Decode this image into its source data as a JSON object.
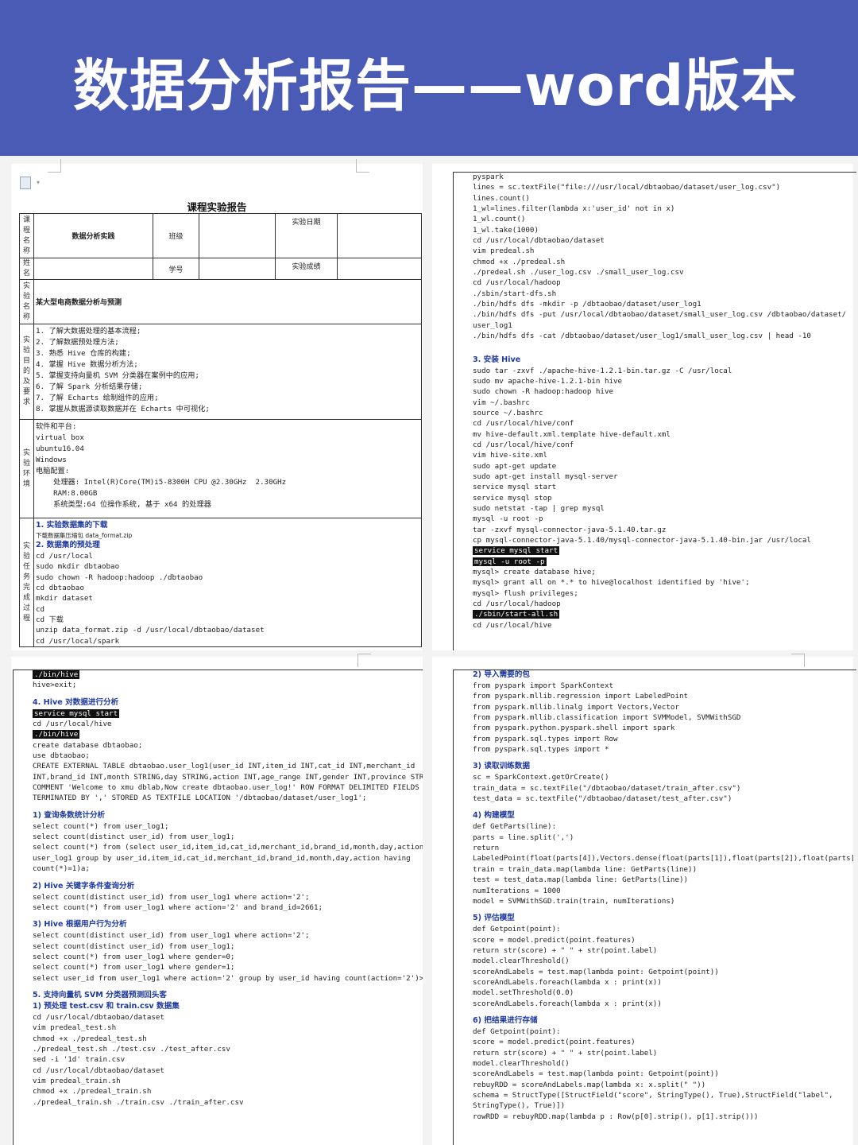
{
  "banner": {
    "title": "数据分析报告——word版本"
  },
  "page1": {
    "doc_title": "课程实验报告",
    "table": {
      "course_label": "课程名称",
      "course_value": "数据分析实践",
      "class_label": "班级",
      "date_label": "实验日期",
      "name_label": "姓名",
      "id_label": "学号",
      "score_label": "实验成绩",
      "exp_name_label": "实验名称",
      "exp_name_value": "某大型电商数据分析与预测",
      "purpose_label": "实验目的及要求",
      "purpose_lines": [
        "1. 了解大数据处理的基本流程;",
        "2. 了解数据预处理方法;",
        "3. 熟悉 Hive 仓库的构建;",
        "4. 掌握 Hive 数据分析方法;",
        "5. 掌握支持向量机 SVM 分类器在案例中的应用;",
        "6. 了解 Spark 分析结果存储;",
        "7. 了解 Echarts 绘制组件的应用;",
        "8. 掌握从数据源读取数据并在 Echarts 中可视化;"
      ],
      "env_label": "实验环境",
      "env_lines": [
        "软件和平台:",
        "virtual box",
        "ubuntu16.04",
        "Windows",
        "电脑配置:",
        "    处理器: Intel(R)Core(TM)i5-8300H CPU @2.30GHz  2.30GHz",
        "    RAM:8.00GB",
        "    系统类型:64 位操作系统, 基于 x64 的处理器"
      ],
      "process_label": "实验任务完成过程",
      "process_lines": [
        {
          "t": "1. 实验数据集的下载",
          "k": "hd"
        },
        {
          "t": "下载数据集压缩包 data_format.zip",
          "k": "small"
        },
        {
          "t": "2. 数据集的预处理",
          "k": "hd"
        },
        {
          "t": "cd /usr/local",
          "k": "ln"
        },
        {
          "t": "sudo mkdir dbtaobao",
          "k": "ln"
        },
        {
          "t": "sudo chown -R hadoop:hadoop ./dbtaobao",
          "k": "ln"
        },
        {
          "t": "cd dbtaobao",
          "k": "ln"
        },
        {
          "t": "mkdir dataset",
          "k": "ln"
        },
        {
          "t": "cd",
          "k": "ln"
        },
        {
          "t": "cd 下载",
          "k": "ln"
        },
        {
          "t": "unzip data_format.zip -d /usr/local/dbtaobao/dataset",
          "k": "ln"
        },
        {
          "t": "cd /usr/local/spark",
          "k": "ln"
        }
      ]
    }
  },
  "page2": {
    "lines": [
      {
        "t": "pyspark",
        "k": "ln"
      },
      {
        "t": "lines = sc.textFile(\"file:///usr/local/dbtaobao/dataset/user_log.csv\")",
        "k": "ln"
      },
      {
        "t": "lines.count()",
        "k": "ln"
      },
      {
        "t": "1_wl=lines.filter(lambda x:'user_id' not in x)",
        "k": "ln"
      },
      {
        "t": "1_wl.count()",
        "k": "ln"
      },
      {
        "t": "1_wl.take(1000)",
        "k": "ln"
      },
      {
        "t": "cd /usr/local/dbtaobao/dataset",
        "k": "ln"
      },
      {
        "t": "vim predeal.sh",
        "k": "ln"
      },
      {
        "t": "chmod +x ./predeal.sh",
        "k": "ln"
      },
      {
        "t": "./predeal.sh ./user_log.csv ./small_user_log.csv",
        "k": "ln"
      },
      {
        "t": "cd /usr/local/hadoop",
        "k": "ln"
      },
      {
        "t": "./sbin/start-dfs.sh",
        "k": "ln"
      },
      {
        "t": "./bin/hdfs dfs -mkdir -p /dbtaobao/dataset/user_log1",
        "k": "ln"
      },
      {
        "t": "./bin/hdfs dfs -put /usr/local/dbtaobao/dataset/small_user_log.csv /dbtaobao/dataset/",
        "k": "ln"
      },
      {
        "t": "user_log1",
        "k": "ln"
      },
      {
        "t": "./bin/hdfs dfs -cat /dbtaobao/dataset/user_log1/small_user_log.csv | head -10",
        "k": "ln"
      },
      {
        "t": "",
        "k": "sp"
      },
      {
        "t": "",
        "k": "sp"
      },
      {
        "t": "3. 安装 Hive",
        "k": "hd"
      },
      {
        "t": "sudo tar -zxvf ./apache-hive-1.2.1-bin.tar.gz -C /usr/local",
        "k": "ln"
      },
      {
        "t": "sudo mv apache-hive-1.2.1-bin hive",
        "k": "ln"
      },
      {
        "t": "sudo chown -R hadoop:hadoop hive",
        "k": "ln"
      },
      {
        "t": "vim ~/.bashrc",
        "k": "ln"
      },
      {
        "t": "source ~/.bashrc",
        "k": "ln"
      },
      {
        "t": "cd /usr/local/hive/conf",
        "k": "ln"
      },
      {
        "t": "mv hive-default.xml.template hive-default.xml",
        "k": "ln"
      },
      {
        "t": "cd /usr/local/hive/conf",
        "k": "ln"
      },
      {
        "t": "vim hive-site.xml",
        "k": "ln"
      },
      {
        "t": "sudo apt-get update",
        "k": "ln"
      },
      {
        "t": "sudo apt-get install mysql-server",
        "k": "ln"
      },
      {
        "t": "service mysql start",
        "k": "ln"
      },
      {
        "t": "service mysql stop",
        "k": "ln"
      },
      {
        "t": "sudo netstat -tap | grep mysql",
        "k": "ln"
      },
      {
        "t": "mysql -u root -p",
        "k": "ln"
      },
      {
        "t": "tar -zxvf mysql-connector-java-5.1.40.tar.gz",
        "k": "ln"
      },
      {
        "t": "cp mysql-connector-java-5.1.40/mysql-connector-java-5.1.40-bin.jar /usr/local",
        "k": "ln"
      },
      {
        "t": "service mysql start",
        "k": "hl"
      },
      {
        "t": "mysql -u root -p",
        "k": "hl"
      },
      {
        "t": "mysql> create database hive;",
        "k": "ln"
      },
      {
        "t": "mysql> grant all on *.* to hive@localhost identified by 'hive';",
        "k": "ln"
      },
      {
        "t": "mysql> flush privileges;",
        "k": "ln"
      },
      {
        "t": "cd /usr/local/hadoop",
        "k": "ln"
      },
      {
        "t": "./sbin/start-all.sh",
        "k": "hl"
      },
      {
        "t": "cd /usr/local/hive",
        "k": "ln"
      }
    ]
  },
  "page3": {
    "lines": [
      {
        "t": "./bin/hive",
        "k": "hl"
      },
      {
        "t": "hive>exit;",
        "k": "ln"
      },
      {
        "t": "",
        "k": "sp"
      },
      {
        "t": "4. Hive 对数据进行分析",
        "k": "hd"
      },
      {
        "t": "service mysql start",
        "k": "hl"
      },
      {
        "t": "cd /usr/local/hive",
        "k": "ln"
      },
      {
        "t": "./bin/hive",
        "k": "hl"
      },
      {
        "t": "create database dbtaobao;",
        "k": "ln"
      },
      {
        "t": "use dbtaobao;",
        "k": "ln"
      },
      {
        "t": "CREATE EXTERNAL TABLE dbtaobao.user_log1(user_id INT,item_id INT,cat_id INT,merchant_id",
        "k": "ln"
      },
      {
        "t": "INT,brand_id INT,month STRING,day STRING,action INT,age_range INT,gender INT,province STRI",
        "k": "ln"
      },
      {
        "t": "COMMENT 'Welcome to xmu dblab,Now create dbtaobao.user_log!' ROW FORMAT DELIMITED FIELDS",
        "k": "ln"
      },
      {
        "t": "TERMINATED BY ',' STORED AS TEXTFILE LOCATION '/dbtaobao/dataset/user_log1';",
        "k": "ln"
      },
      {
        "t": "",
        "k": "sp"
      },
      {
        "t": "1) 查询条数统计分析",
        "k": "hd"
      },
      {
        "t": "select count(*) from user_log1;",
        "k": "ln"
      },
      {
        "t": "select count(distinct user_id) from user_log1;",
        "k": "ln"
      },
      {
        "t": "select count(*) from (select user_id,item_id,cat_id,merchant_id,brand_id,month,day,action f",
        "k": "ln"
      },
      {
        "t": "user_log1 group by user_id,item_id,cat_id,merchant_id,brand_id,month,day,action having",
        "k": "ln"
      },
      {
        "t": "count(*)=1)a;",
        "k": "ln"
      },
      {
        "t": "",
        "k": "sp"
      },
      {
        "t": "2) Hive 关键字条件查询分析",
        "k": "hd"
      },
      {
        "t": "select count(distinct user_id) from user_log1 where action='2';",
        "k": "ln"
      },
      {
        "t": "select count(*) from user_log1 where action='2' and brand_id=2661;",
        "k": "ln"
      },
      {
        "t": "",
        "k": "sp"
      },
      {
        "t": "3) Hive 根据用户行为分析",
        "k": "hd"
      },
      {
        "t": "select count(distinct user_id) from user_log1 where action='2';",
        "k": "ln"
      },
      {
        "t": "select count(distinct user_id) from user_log1;",
        "k": "ln"
      },
      {
        "t": "select count(*) from user_log1 where gender=0;",
        "k": "ln"
      },
      {
        "t": "select count(*) from user_log1 where gender=1;",
        "k": "ln"
      },
      {
        "t": "select user_id from user_log1 where action='2' group by user_id having count(action='2')>",
        "k": "ln"
      },
      {
        "t": "",
        "k": "sp"
      },
      {
        "t": "5. 支持向量机 SVM 分类器预测回头客",
        "k": "hd"
      },
      {
        "t": "1) 预处理 test.csv 和 train.csv 数据集",
        "k": "hd"
      },
      {
        "t": "cd /usr/local/dbtaobao/dataset",
        "k": "ln"
      },
      {
        "t": "vim predeal_test.sh",
        "k": "ln"
      },
      {
        "t": "chmod +x ./predeal_test.sh",
        "k": "ln"
      },
      {
        "t": "./predeal_test.sh ./test.csv ./test_after.csv",
        "k": "ln"
      },
      {
        "t": "sed -i '1d' train.csv",
        "k": "ln"
      },
      {
        "t": "cd /usr/local/dbtaobao/dataset",
        "k": "ln"
      },
      {
        "t": "vim predeal_train.sh",
        "k": "ln"
      },
      {
        "t": "chmod +x ./predeal_train.sh",
        "k": "ln"
      },
      {
        "t": "./predeal_train.sh ./train.csv ./train_after.csv",
        "k": "ln"
      }
    ]
  },
  "page4": {
    "lines": [
      {
        "t": "2) 导入需要的包",
        "k": "hd"
      },
      {
        "t": "from pyspark import SparkContext",
        "k": "ln"
      },
      {
        "t": "from pyspark.mllib.regression import LabeledPoint",
        "k": "ln"
      },
      {
        "t": "from pyspark.mllib.linalg import Vectors,Vector",
        "k": "ln"
      },
      {
        "t": "from pyspark.mllib.classification import SVMModel, SVMWithSGD",
        "k": "ln"
      },
      {
        "t": "from pyspark.python.pyspark.shell import spark",
        "k": "ln"
      },
      {
        "t": "from pyspark.sql.types import Row",
        "k": "ln"
      },
      {
        "t": "from pyspark.sql.types import *",
        "k": "ln"
      },
      {
        "t": "",
        "k": "sp"
      },
      {
        "t": "3) 读取训练数据",
        "k": "hd"
      },
      {
        "t": "sc = SparkContext.getOrCreate()",
        "k": "ln"
      },
      {
        "t": "train_data = sc.textFile(\"/dbtaobao/dataset/train_after.csv\")",
        "k": "ln"
      },
      {
        "t": "test_data = sc.textFile(\"/dbtaobao/dataset/test_after.csv\")",
        "k": "ln"
      },
      {
        "t": "",
        "k": "sp"
      },
      {
        "t": "4) 构建模型",
        "k": "hd"
      },
      {
        "t": "def GetParts(line):",
        "k": "ln"
      },
      {
        "t": "parts = line.split(',')",
        "k": "ln"
      },
      {
        "t": "return",
        "k": "ln"
      },
      {
        "t": "LabeledPoint(float(parts[4]),Vectors.dense(float(parts[1]),float(parts[2]),float(parts[3",
        "k": "ln"
      },
      {
        "t": "train = train_data.map(lambda line: GetParts(line))",
        "k": "ln"
      },
      {
        "t": "test = test_data.map(lambda line: GetParts(line))",
        "k": "ln"
      },
      {
        "t": "numIterations = 1000",
        "k": "ln"
      },
      {
        "t": "model = SVMWithSGD.train(train, numIterations)",
        "k": "ln"
      },
      {
        "t": "",
        "k": "sp"
      },
      {
        "t": "5) 评估模型",
        "k": "hd"
      },
      {
        "t": "def Getpoint(point):",
        "k": "ln"
      },
      {
        "t": "score = model.predict(point.features)",
        "k": "ln"
      },
      {
        "t": "return str(score) + \" \" + str(point.label)",
        "k": "ln"
      },
      {
        "t": "model.clearThreshold()",
        "k": "ln"
      },
      {
        "t": "scoreAndLabels = test.map(lambda point: Getpoint(point))",
        "k": "ln"
      },
      {
        "t": "scoreAndLabels.foreach(lambda x : print(x))",
        "k": "ln"
      },
      {
        "t": "model.setThreshold(0.0)",
        "k": "ln"
      },
      {
        "t": "scoreAndLabels.foreach(lambda x : print(x))",
        "k": "ln"
      },
      {
        "t": "",
        "k": "sp"
      },
      {
        "t": "6) 把结果进行存储",
        "k": "hd"
      },
      {
        "t": "def Getpoint(point):",
        "k": "ln"
      },
      {
        "t": "score = model.predict(point.features)",
        "k": "ln"
      },
      {
        "t": "return str(score) + \" \" + str(point.label)",
        "k": "ln"
      },
      {
        "t": "model.clearThreshold()",
        "k": "ln"
      },
      {
        "t": "scoreAndLabels = test.map(lambda point: Getpoint(point))",
        "k": "ln"
      },
      {
        "t": "rebuyRDD = scoreAndLabels.map(lambda x: x.split(\" \"))",
        "k": "ln"
      },
      {
        "t": "schema = StructType([StructField(\"score\", StringType(), True),StructField(\"label\",",
        "k": "ln"
      },
      {
        "t": "StringType(), True)])",
        "k": "ln"
      },
      {
        "t": "rowRDD = rebuyRDD.map(lambda p : Row(p[0].strip(), p[1].strip()))",
        "k": "ln"
      }
    ]
  }
}
